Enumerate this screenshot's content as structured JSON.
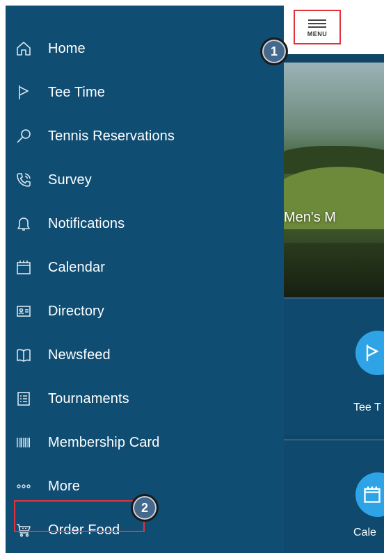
{
  "sidebar": {
    "items": [
      {
        "label": "Home",
        "icon": "home-icon"
      },
      {
        "label": "Tee Time",
        "icon": "flag-icon"
      },
      {
        "label": "Tennis Reservations",
        "icon": "tennis-racket-icon"
      },
      {
        "label": "Survey",
        "icon": "phone-icon"
      },
      {
        "label": "Notifications",
        "icon": "bell-icon"
      },
      {
        "label": "Calendar",
        "icon": "calendar-icon"
      },
      {
        "label": "Directory",
        "icon": "id-card-icon"
      },
      {
        "label": "Newsfeed",
        "icon": "book-icon"
      },
      {
        "label": "Tournaments",
        "icon": "list-icon"
      },
      {
        "label": "Membership Card",
        "icon": "barcode-icon"
      },
      {
        "label": "More",
        "icon": "more-dots-icon"
      },
      {
        "label": "Order Food",
        "icon": "cart-icon"
      }
    ]
  },
  "topbar": {
    "menu_label": "MENU"
  },
  "hero": {
    "title": "Men's M"
  },
  "tiles": [
    {
      "label": "Tee T",
      "icon": "flag-icon"
    },
    {
      "label": "Cale",
      "icon": "calendar-icon"
    }
  ],
  "callouts": {
    "first": "1",
    "second": "2"
  },
  "colors": {
    "sidebar_bg": "#0f4d73",
    "accent_circle": "#2ea4e6",
    "highlight": "#e0333c",
    "callout_bg": "#45698c"
  }
}
